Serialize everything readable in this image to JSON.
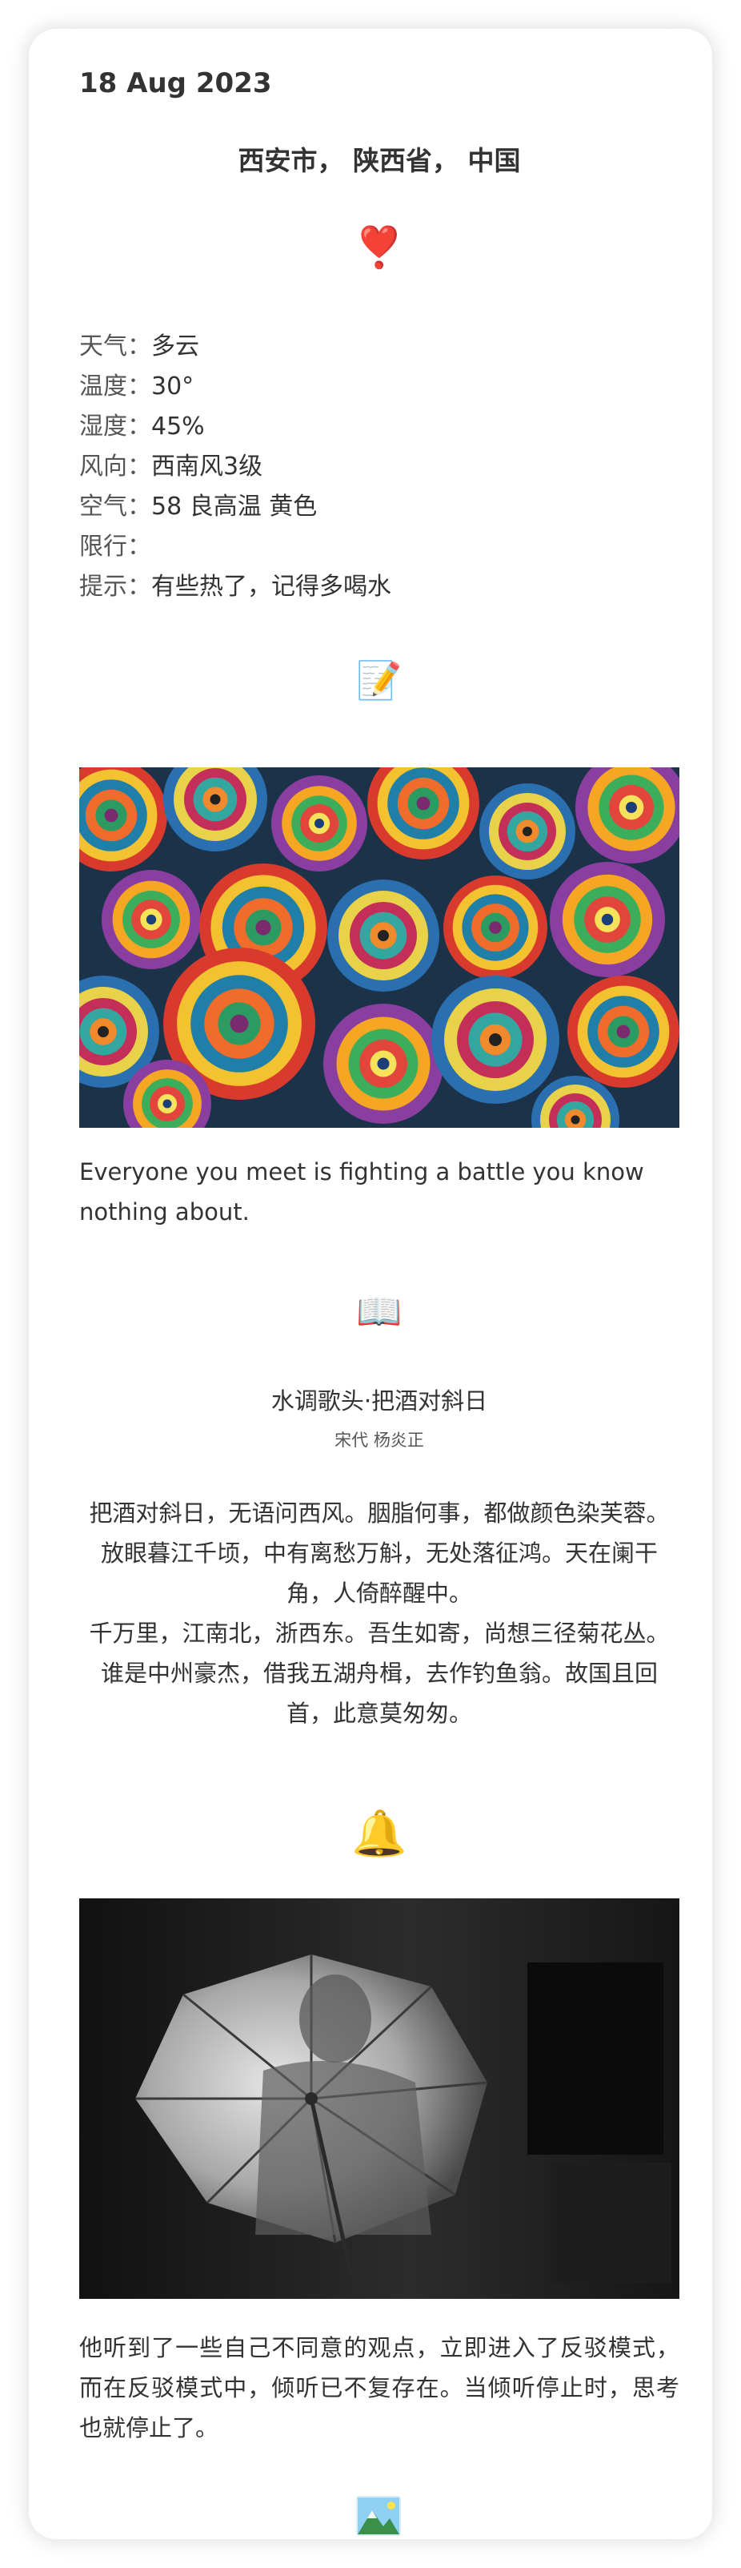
{
  "header": {
    "date": "18 Aug 2023",
    "location": "西安市， 陕西省， 中国"
  },
  "icons": {
    "heart": "❣️",
    "memo": "📝",
    "book": "📖",
    "bell": "🔔"
  },
  "weather": [
    {
      "key": "天气：",
      "value": "多云"
    },
    {
      "key": "温度：",
      "value": "30°"
    },
    {
      "key": "湿度：",
      "value": "45%"
    },
    {
      "key": "风向：",
      "value": "西南风3级"
    },
    {
      "key": "空气：",
      "value": "58 良高温 黄色"
    },
    {
      "key": "限行：",
      "value": ""
    },
    {
      "key": "提示：",
      "value": "有些热了，记得多喝水"
    }
  ],
  "quote_en": "  Everyone you meet is fighting a battle you know nothing about.",
  "poem": {
    "title": "水调歌头·把酒对斜日",
    "meta": "宋代 杨炎正",
    "lines": [
      "把酒对斜日，无语问西风。胭脂何事，都做颜色染芙蓉。放眼暮江千顷，中有离愁万斛，无处落征鸿。天在阑干角，人倚醉醒中。",
      "千万里，江南北，浙西东。吾生如寄，尚想三径菊花丛。谁是中州豪杰，借我五湖舟楫，去作钓鱼翁。故国且回首，此意莫匆匆。"
    ]
  },
  "quote_cn": "  他听到了一些自己不同意的观点，立即进入了反驳模式，而在反驳模式中，倾听已不复存在。当倾听停止时，思考也就停止了。",
  "colors": {
    "text": "#333333",
    "card_bg": "#ffffff"
  }
}
